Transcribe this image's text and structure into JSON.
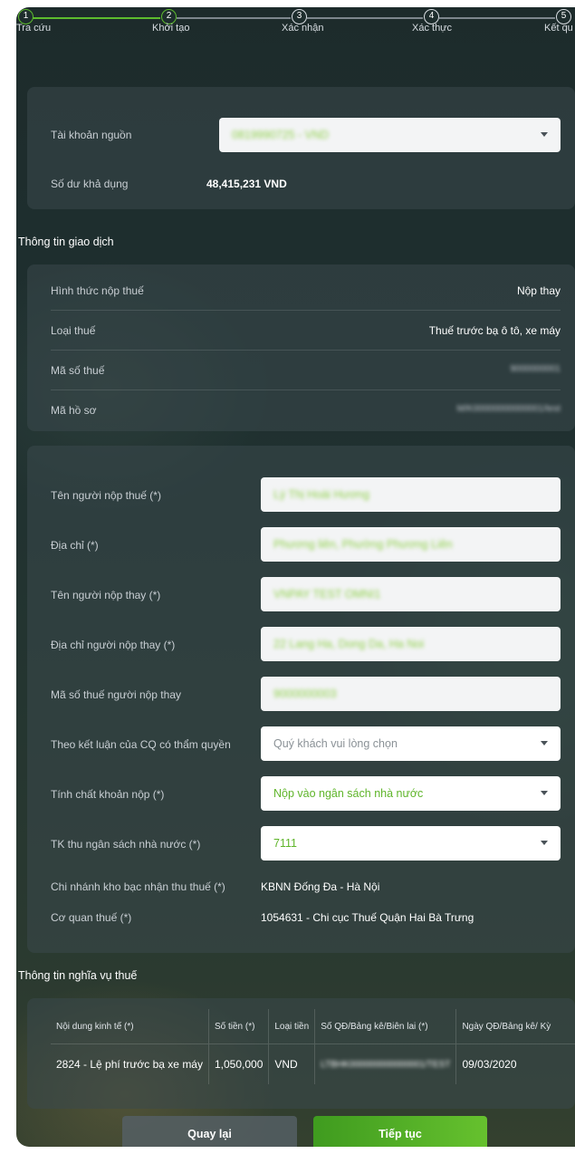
{
  "stepper": {
    "steps": [
      {
        "number": "1",
        "label": "Tra cứu"
      },
      {
        "number": "2",
        "label": "Khởi tạo"
      },
      {
        "number": "3",
        "label": "Xác nhận"
      },
      {
        "number": "4",
        "label": "Xác thực"
      },
      {
        "number": "5",
        "label": "Kết qu"
      }
    ]
  },
  "source": {
    "account_label": "Tài khoản nguồn",
    "account_value": "0819990725 - VND",
    "balance_label": "Số dư khả dụng",
    "balance_value": "48,415,231 VND"
  },
  "transaction": {
    "title": "Thông tin giao dịch",
    "rows": [
      {
        "label": "Hình thức nộp thuế",
        "value": "Nộp thay"
      },
      {
        "label": "Loại thuế",
        "value": "Thuế trước bạ ô tô, xe máy"
      },
      {
        "label": "Mã số thuế",
        "value": "9000000001"
      },
      {
        "label": "Mã hồ sơ",
        "value": "M/K00000000000001/test"
      }
    ]
  },
  "form": {
    "taxpayer_name_label": "Tên người nộp thuế (*)",
    "taxpayer_name_value": "Lý Thị Hoài Hương",
    "address_label": "Địa chỉ (*)",
    "address_value": "Phương liên, Phường Phương Liên",
    "payer_name_label": "Tên người nộp thay (*)",
    "payer_name_value": "VNPAY TEST OMNI1",
    "payer_address_label": "Địa chỉ người nộp thay (*)",
    "payer_address_value": "22 Lang Ha, Dong Da, Ha Noi",
    "payer_tax_label": "Mã số thuế người nộp thay",
    "payer_tax_value": "9000000003",
    "conclusion_label": "Theo kết luận của CQ có thẩm quyền",
    "conclusion_placeholder": "Quý khách vui lòng chọn",
    "nature_label": "Tính chất khoản nộp (*)",
    "nature_value": "Nộp vào ngân sách nhà nước",
    "budget_label": "TK thu ngân sách nhà nước (*)",
    "budget_value": "7111",
    "treasury_label": "Chi nhánh kho bạc nhận thu thuế (*)",
    "treasury_value": "KBNN Đống Đa - Hà Nội",
    "tax_office_label": "Cơ quan thuế (*)",
    "tax_office_value": "1054631 - Chi cục Thuế Quận Hai Bà Trưng"
  },
  "obligation": {
    "title": "Thông tin nghĩa vụ thuế",
    "columns": [
      "Nội dung kinh tế (*)",
      "Số tiền (*)",
      "Loại tiền",
      "Số QĐ/Bảng kê/Biên lai (*)",
      "Ngày QĐ/Bảng kê/ Kỳ"
    ],
    "row": {
      "content": "2824 - Lệ phí trước bạ xe máy",
      "amount": "1,050,000",
      "currency": "VND",
      "decision_no": "LTBHK000000000000001/TEST",
      "date": "09/03/2020"
    }
  },
  "actions": {
    "back_label": "Quay lại",
    "continue_label": "Tiếp tục"
  },
  "colors": {
    "accent": "#5dbb2e",
    "background": "#1f3030",
    "card": "#3a484c"
  }
}
